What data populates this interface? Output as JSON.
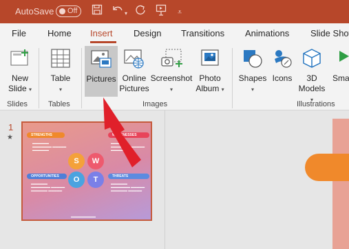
{
  "titlebar": {
    "autosave_label": "AutoSave",
    "autosave_state": "Off",
    "icons": [
      "save-icon",
      "undo-icon",
      "redo-icon",
      "present-icon",
      "customize-icon"
    ]
  },
  "tabs": [
    "File",
    "Home",
    "Insert",
    "Design",
    "Transitions",
    "Animations",
    "Slide Show"
  ],
  "active_tab": "Insert",
  "ribbon": {
    "new_slide": [
      "New",
      "Slide"
    ],
    "table": "Table",
    "pictures": "Pictures",
    "online_pictures": [
      "Online",
      "Pictures"
    ],
    "screenshot": "Screenshot",
    "photo_album": [
      "Photo",
      "Album"
    ],
    "shapes": "Shapes",
    "icons": "Icons",
    "models_3d": [
      "3D",
      "Models"
    ],
    "smartart": "Sma",
    "groups": {
      "slides": "Slides",
      "tables": "Tables",
      "images": "Images",
      "illustrations": "Illustrations"
    }
  },
  "slides_pane": {
    "slide_number": "1",
    "thumbnail": {
      "strengths": "STRENGTHS",
      "weaknesses": "WEAKNESSES",
      "opportunities": "OPPORTUNITIES",
      "threats": "THREATS",
      "letters": [
        "S",
        "W",
        "O",
        "T"
      ]
    }
  },
  "colors": {
    "accent": "#b7472a",
    "annotation_arrow": "#e0202a",
    "selected_button": "#c8c8c8"
  }
}
